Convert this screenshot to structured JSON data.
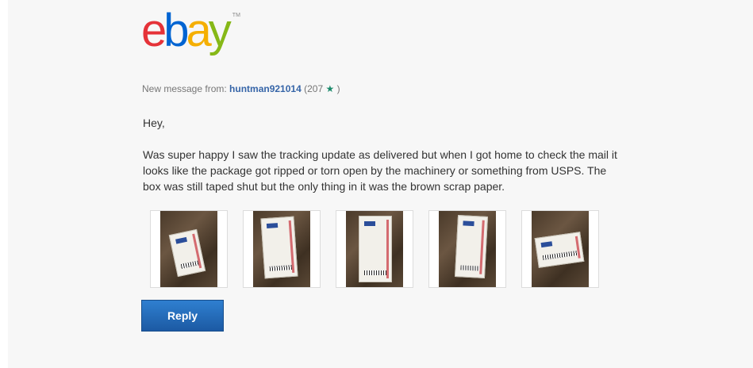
{
  "logo": {
    "letters": [
      "e",
      "b",
      "a",
      "y"
    ],
    "tm": "TM",
    "colors": [
      "#e53238",
      "#0064d2",
      "#f5af02",
      "#86b817"
    ]
  },
  "header": {
    "prefix": "New message from:",
    "username": "huntman921014",
    "feedback_open": "(207",
    "feedback_close": ")",
    "star_icon": "teal-star-icon"
  },
  "message": {
    "greeting": "Hey,",
    "body": "Was super happy I saw the tracking update as delivered but when I got home to check the mail it looks like the package got ripped or torn open by the machinery or something from USPS. The box was still taped shut but the only thing in it was the brown scrap paper."
  },
  "photos": [
    {
      "name": "photo-1"
    },
    {
      "name": "photo-2"
    },
    {
      "name": "photo-3"
    },
    {
      "name": "photo-4"
    },
    {
      "name": "photo-5"
    }
  ],
  "actions": {
    "reply_label": "Reply"
  },
  "colors": {
    "username": "#3665a8",
    "reply_button": "#1c5aa3",
    "star": "#1b8a6b"
  }
}
